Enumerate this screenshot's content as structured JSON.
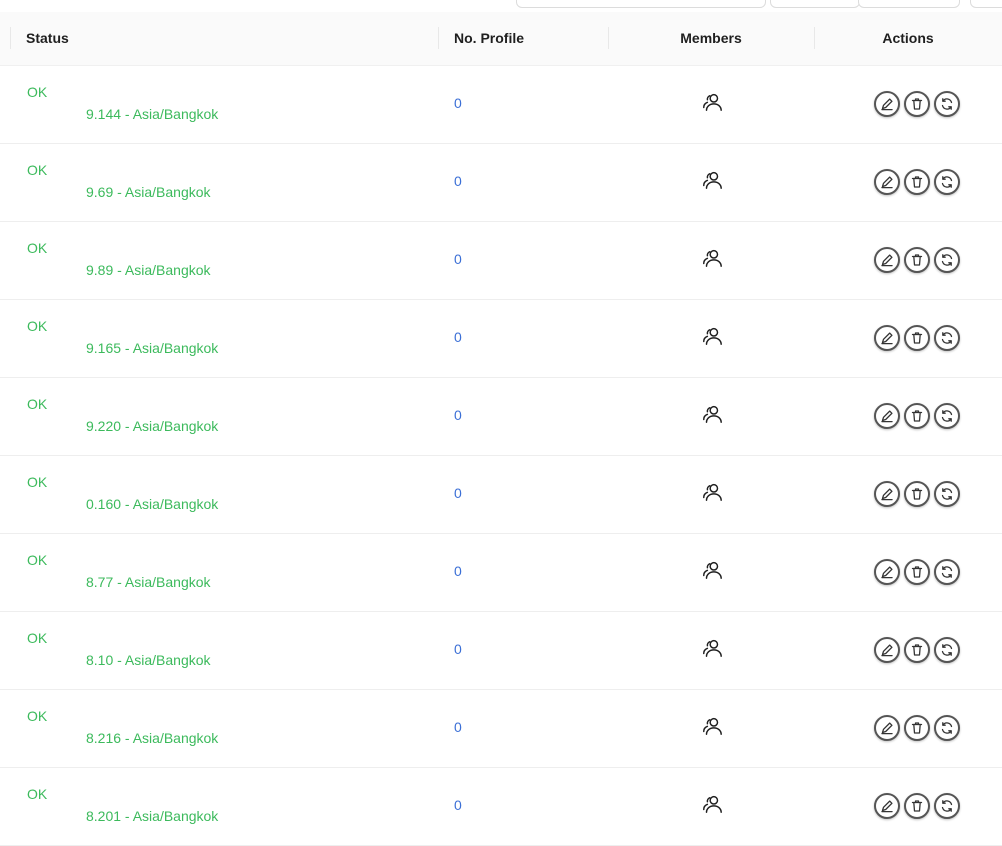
{
  "table": {
    "columns": {
      "status": "Status",
      "profiles": "No. Profile",
      "members": "Members",
      "actions": "Actions"
    },
    "rows": [
      {
        "status": "OK",
        "proxy": "9.144 - Asia/Bangkok",
        "profiles": "0"
      },
      {
        "status": "OK",
        "proxy": "9.69 - Asia/Bangkok",
        "profiles": "0"
      },
      {
        "status": "OK",
        "proxy": "9.89 - Asia/Bangkok",
        "profiles": "0"
      },
      {
        "status": "OK",
        "proxy": "9.165 - Asia/Bangkok",
        "profiles": "0"
      },
      {
        "status": "OK",
        "proxy": "9.220 - Asia/Bangkok",
        "profiles": "0"
      },
      {
        "status": "OK",
        "proxy": "0.160 - Asia/Bangkok",
        "profiles": "0"
      },
      {
        "status": "OK",
        "proxy": "8.77 - Asia/Bangkok",
        "profiles": "0"
      },
      {
        "status": "OK",
        "proxy": "8.10 - Asia/Bangkok",
        "profiles": "0"
      },
      {
        "status": "OK",
        "proxy": "8.216 - Asia/Bangkok",
        "profiles": "0"
      },
      {
        "status": "OK",
        "proxy": "8.201 - Asia/Bangkok",
        "profiles": "0"
      }
    ]
  },
  "icons": {
    "members": "users-icon",
    "edit": "edit-icon",
    "delete": "trash-icon",
    "sync": "refresh-icon"
  },
  "colors": {
    "status_ok": "#3cba5c",
    "profile_link": "#3b6fd6",
    "header_bg": "#fafafa"
  }
}
